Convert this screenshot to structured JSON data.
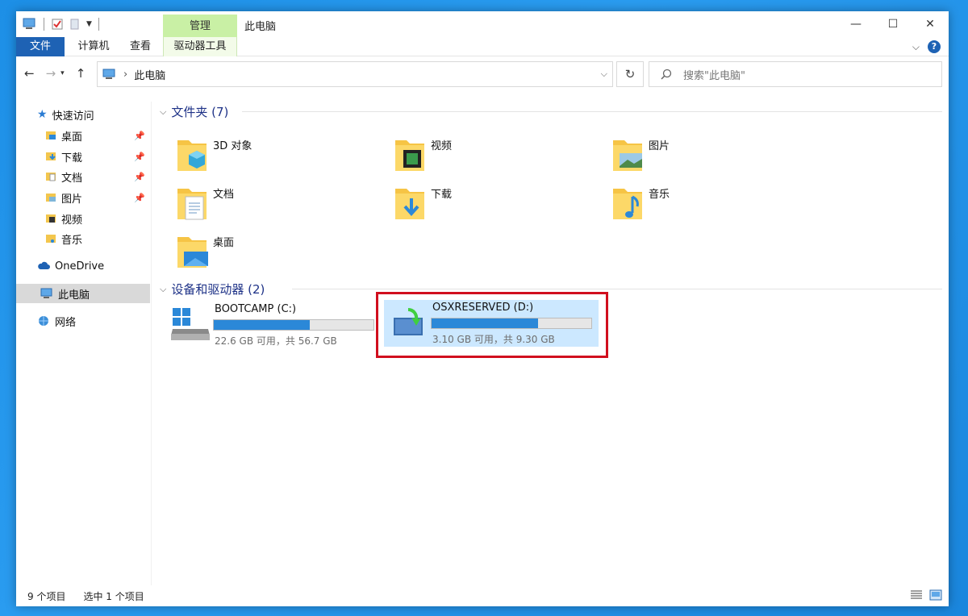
{
  "window": {
    "title": "此电脑",
    "context_tab_group": "管理",
    "controls": {
      "minimize": "—",
      "maximize": "☐",
      "close": "✕"
    }
  },
  "ribbon": {
    "tabs": [
      {
        "label": "文件"
      },
      {
        "label": "计算机"
      },
      {
        "label": "查看"
      },
      {
        "label": "驱动器工具"
      }
    ],
    "help": "?"
  },
  "address": {
    "path": "此电脑",
    "separator": "›",
    "search_placeholder": "搜索\"此电脑\""
  },
  "sidebar": {
    "quick_access": "快速访问",
    "items": [
      {
        "label": "桌面",
        "pinned": true
      },
      {
        "label": "下载",
        "pinned": true
      },
      {
        "label": "文档",
        "pinned": true
      },
      {
        "label": "图片",
        "pinned": true
      },
      {
        "label": "视频",
        "pinned": false
      },
      {
        "label": "音乐",
        "pinned": false
      }
    ],
    "onedrive": "OneDrive",
    "this_pc": "此电脑",
    "network": "网络"
  },
  "folders_group": {
    "title": "文件夹 (7)",
    "items": [
      {
        "label": "3D 对象",
        "icon": "3d-objects-icon"
      },
      {
        "label": "视频",
        "icon": "videos-icon"
      },
      {
        "label": "图片",
        "icon": "pictures-icon"
      },
      {
        "label": "文档",
        "icon": "documents-icon"
      },
      {
        "label": "下载",
        "icon": "downloads-icon"
      },
      {
        "label": "音乐",
        "icon": "music-icon"
      },
      {
        "label": "桌面",
        "icon": "desktop-icon"
      }
    ]
  },
  "drives_group": {
    "title": "设备和驱动器 (2)",
    "drives": [
      {
        "label": "BOOTCAMP (C:)",
        "usage": "22.6 GB 可用，共 56.7 GB",
        "used_fraction": 0.6,
        "selected": false
      },
      {
        "label": "OSXRESERVED (D:)",
        "usage": "3.10 GB 可用，共 9.30 GB",
        "used_fraction": 0.667,
        "selected": true
      }
    ]
  },
  "status": {
    "item_count": "9 个项目",
    "selected_count": "选中 1 个项目"
  },
  "colors": {
    "accent": "#1e62b4",
    "bar_fill": "#2b88d8",
    "selection": "#cce8ff",
    "highlight_box": "#d10f1e",
    "context_tab": "#c9f0a5"
  }
}
